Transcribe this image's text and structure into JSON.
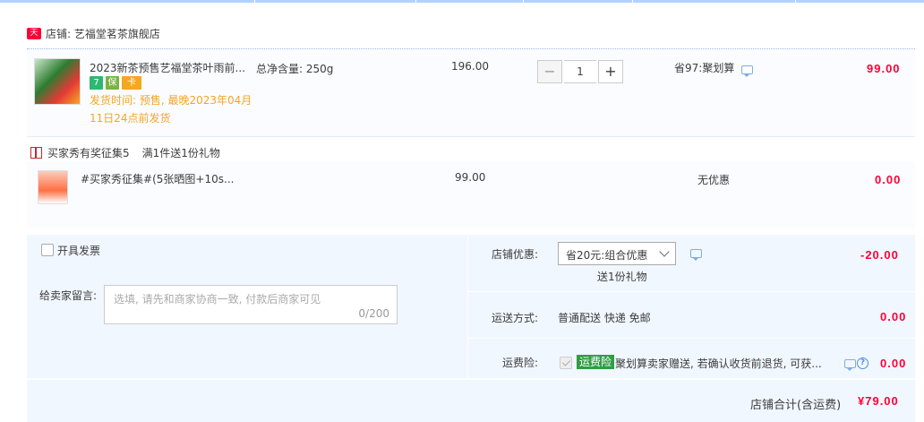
{
  "shop": {
    "badge": "天猫",
    "name": "店铺: 艺福堂茗茶旗舰店"
  },
  "item1": {
    "title": "2023新茶预售艺福堂茶叶雨前...",
    "spec": "总净含量: 250g",
    "ship_time": "发货时间: 预售, 最晚2023年04月11日24点前发货",
    "badges": [
      "7",
      "保",
      "卡"
    ],
    "unit_price": "196.00",
    "quantity": "1",
    "discount": "省97:聚划算",
    "subtotal": "99.00"
  },
  "gift_promo": {
    "label": "买家秀有奖征集5",
    "rule": "满1件送1份礼物"
  },
  "item2": {
    "title": "#买家秀征集#(5张晒图+10s...",
    "unit_price": "99.00",
    "discount": "无优惠",
    "subtotal": "0.00"
  },
  "invoice": {
    "label": "开具发票"
  },
  "message": {
    "label": "给卖家留言:",
    "placeholder": "选填, 请先和商家协商一致, 付款后商家可见",
    "count": "0/200"
  },
  "shop_discount": {
    "label": "店铺优惠:",
    "selected": "省20元:组合优惠",
    "note": "送1份礼物",
    "amount": "-20.00"
  },
  "shipping": {
    "label": "运送方式:",
    "value": "普通配送 快递 免邮",
    "amount": "0.00"
  },
  "insurance": {
    "label": "运费险:",
    "tag": "运费险",
    "desc": "聚划算卖家赠送, 若确认收货前退货, 可获...",
    "amount": "0.00"
  },
  "total": {
    "label": "店铺合计(含运费)",
    "amount": "¥79.00"
  },
  "colors": {
    "price_red": "#ff0036",
    "panel_bg": "#f1f7ff",
    "ship_orange": "#f5a623",
    "ins_green": "#2e9e45"
  }
}
